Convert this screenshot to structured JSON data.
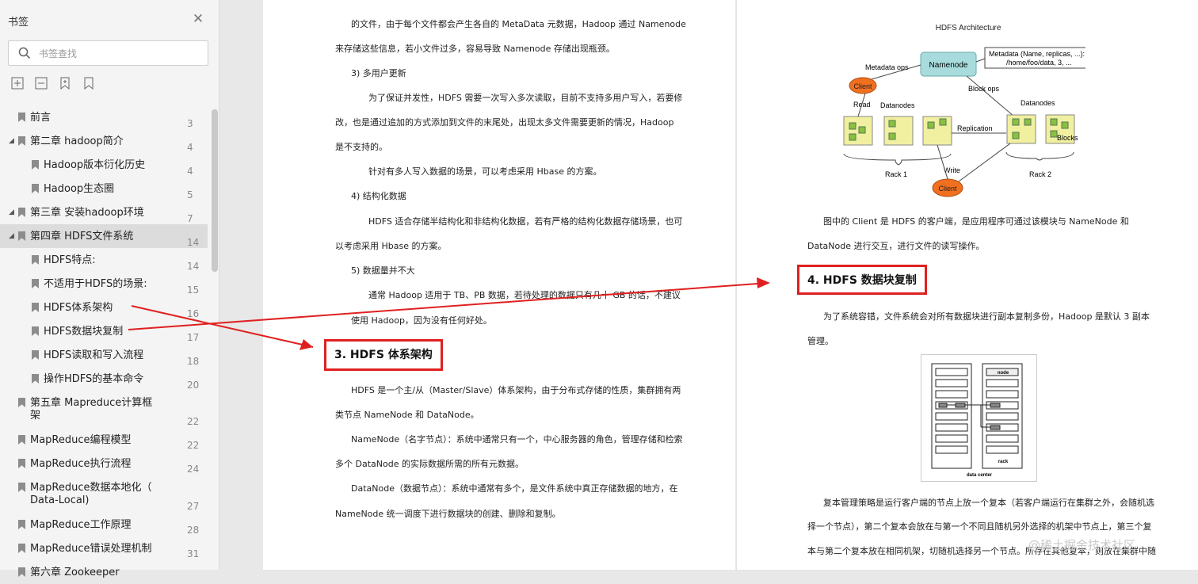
{
  "sidebar": {
    "title": "书签",
    "close_icon": "close-icon",
    "search_placeholder": "书签查找",
    "tools": [
      "expand-all-icon",
      "collapse-all-icon",
      "add-bookmark-icon",
      "bookmark-icon"
    ],
    "items": [
      {
        "label": "前言",
        "page": "3"
      },
      {
        "label": "第二章 hadoop简介",
        "page": "4"
      },
      {
        "label": "Hadoop版本衍化历史",
        "page": "4"
      },
      {
        "label": "Hadoop生态圈",
        "page": "5"
      },
      {
        "label": "第三章 安装hadoop环境",
        "page": "7"
      },
      {
        "label": "第四章  HDFS文件系统",
        "page": "14"
      },
      {
        "label": "HDFS特点:",
        "page": "14"
      },
      {
        "label": "不适用于HDFS的场景:",
        "page": "15"
      },
      {
        "label": "HDFS体系架构",
        "page": "16"
      },
      {
        "label": "HDFS数据块复制",
        "page": "17"
      },
      {
        "label": "HDFS读取和写入流程",
        "page": "18"
      },
      {
        "label": "操作HDFS的基本命令",
        "page": "20"
      },
      {
        "label": "第五章  Mapreduce计算框",
        "label2": "架",
        "page": "22"
      },
      {
        "label": "MapReduce编程模型",
        "page": "22"
      },
      {
        "label": "MapReduce执行流程",
        "page": "24"
      },
      {
        "label": "MapReduce数据本地化（",
        "label2": "Data-Local)",
        "page": "27"
      },
      {
        "label": "MapReduce工作原理",
        "page": "28"
      },
      {
        "label": "MapReduce错误处理机制",
        "page": "31"
      },
      {
        "label": "第六章 Zookeeper",
        "page": ""
      }
    ]
  },
  "page1": {
    "lines": [
      "的文件，由于每个文件都会产生各自的 MetaData 元数据，Hadoop 通过 Namenode",
      "来存储这些信息，若小文件过多，容易导致 Namenode 存储出现瓶颈。",
      "3)      多用户更新",
      "为了保证并发性，HDFS 需要一次写入多次读取，目前不支持多用户写入，若要修",
      "改，也是通过追加的方式添加到文件的末尾处，出现太多文件需要更新的情况，Hadoop",
      "是不支持的。",
      "针对有多人写入数据的场景，可以考虑采用 Hbase 的方案。",
      "4)      结构化数据",
      "HDFS 适合存储半结构化和非结构化数据，若有严格的结构化数据存储场景，也可",
      "以考虑采用 Hbase 的方案。",
      "5)      数据量并不大",
      "通常 Hadoop 适用于 TB、PB 数据，若待处理的数据只有几十 GB 的话，不建议",
      "使用 Hadoop，因为没有任何好处。"
    ],
    "heading": "3.  HDFS 体系架构",
    "lines2": [
      "HDFS 是一个主/从（Master/Slave）体系架构，由于分布式存储的性质，集群拥有两",
      "类节点 NameNode 和 DataNode。",
      "NameNode（名字节点）：系统中通常只有一个，中心服务器的角色，管理存储和检索",
      "多个 DataNode 的实际数据所需的所有元数据。",
      "DataNode（数据节点）：系统中通常有多个，是文件系统中真正存储数据的地方，在",
      "NameNode 统一调度下进行数据块的创建、删除和复制。"
    ]
  },
  "page2": {
    "diagram": {
      "title": "HDFS Architecture",
      "namenode": "Namenode",
      "metadata": "Metadata (Name, replicas, ...):",
      "metadata2": "/home/foo/data, 3, ...",
      "metadata_ops": "Metadata ops",
      "client": "Client",
      "read": "Read",
      "datanodes": "Datanodes",
      "block_ops": "Block ops",
      "replication": "Replication",
      "blocks": "Blocks",
      "write": "Write",
      "rack1": "Rack 1",
      "rack2": "Rack 2"
    },
    "lines": [
      "图中的 Client 是 HDFS 的客户端，是应用程序可通过该模块与 NameNode 和",
      "DataNode 进行交互，进行文件的读写操作。"
    ],
    "heading": "4.  HDFS 数据块复制",
    "lines2": [
      "为了系统容错，文件系统会对所有数据块进行副本复制多份，Hadoop 是默认 3 副本",
      "管理。"
    ],
    "rack_labels": {
      "node": "node",
      "rack": "rack",
      "dc": "data center"
    },
    "lines3": [
      "复本管理策略是运行客户端的节点上放一个复本（若客户端运行在集群之外，会随机选",
      "择一个节点），第二个复本会放在与第一个不同且随机另外选择的机架中节点上，第三个复",
      "本与第二个复本放在相同机架，切随机选择另一个节点。所存在其他复本，则放在集群中随"
    ]
  },
  "watermark": "@稀土掘金技术社区",
  "colors": {
    "accent_red": "#e02020",
    "namenode_fill": "#a8dcdc",
    "client_fill": "#f07020",
    "datanode_fill": "#f0f0a0",
    "block_fill": "#8ac040"
  }
}
